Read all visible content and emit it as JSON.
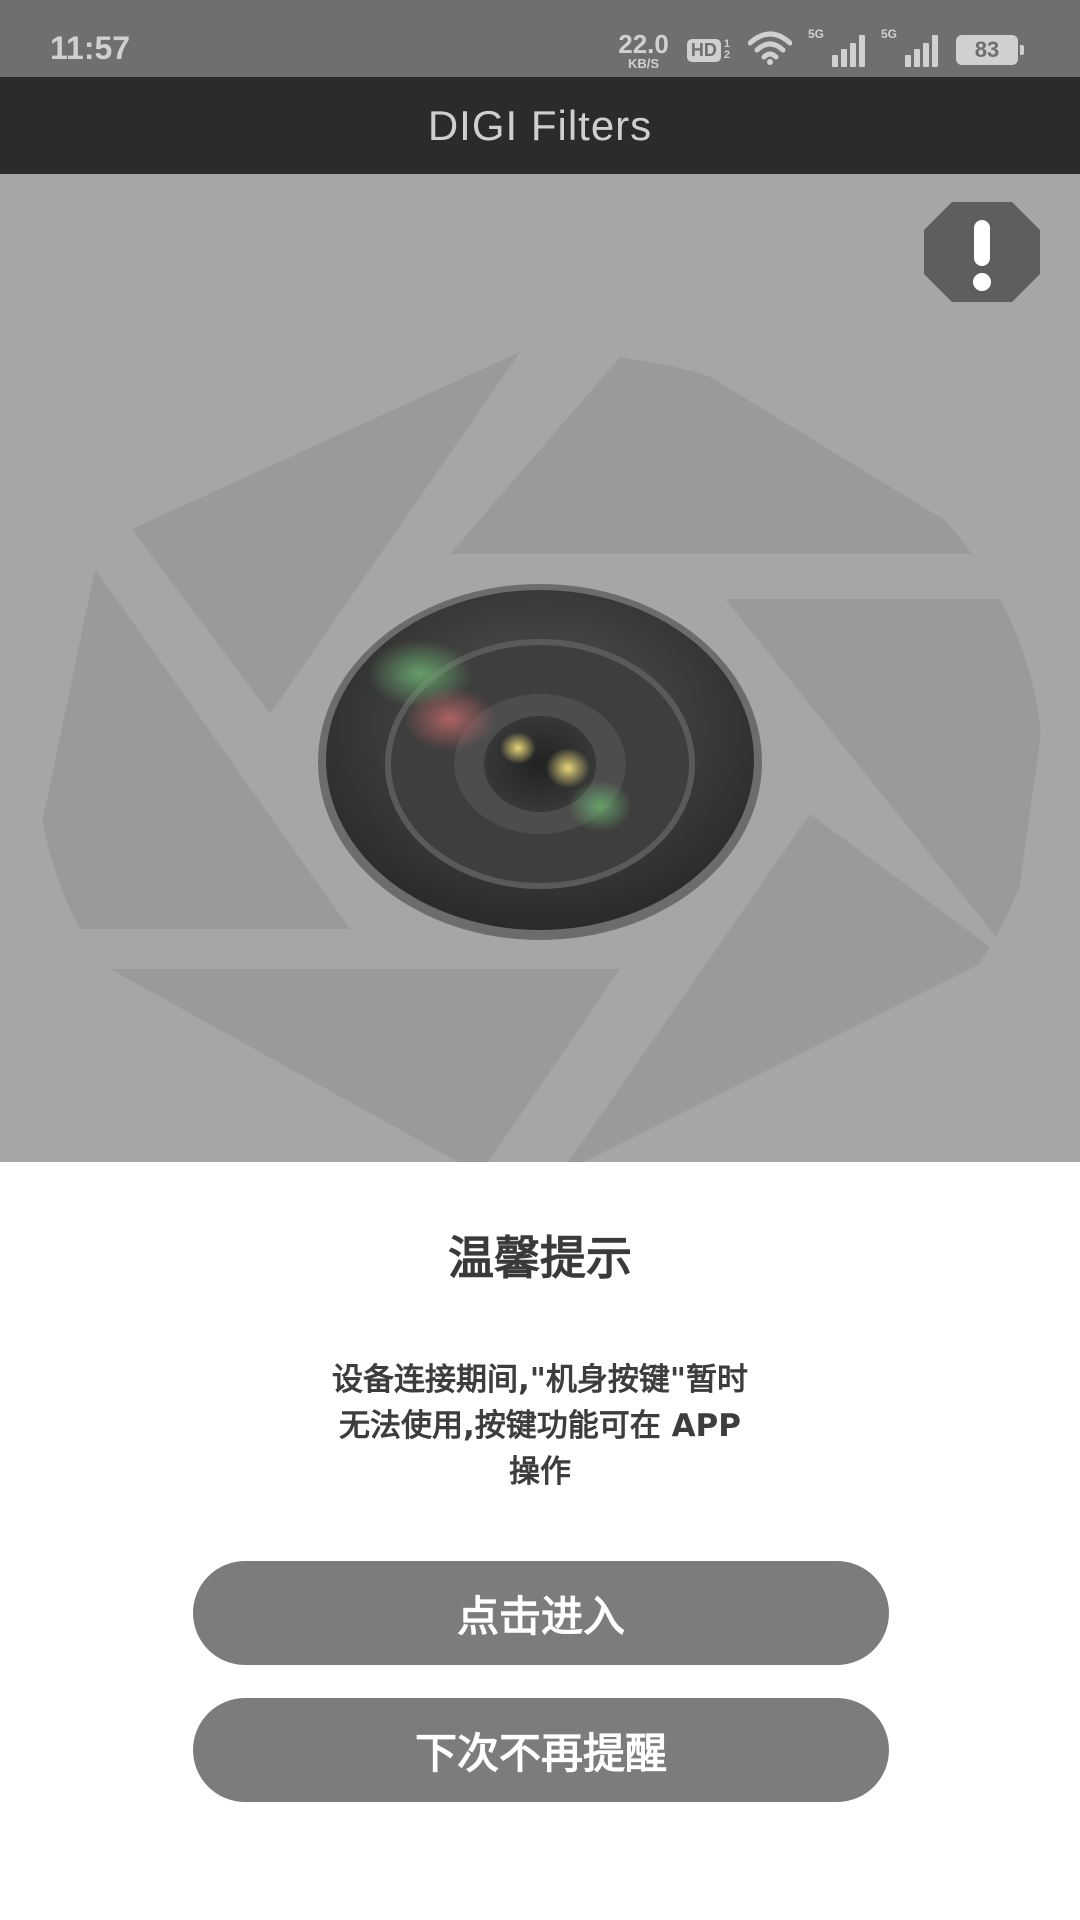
{
  "status_bar": {
    "time": "11:57",
    "net_speed_value": "22.0",
    "net_speed_unit": "KB/S",
    "hd_label": "HD",
    "hd_sub_top": "1",
    "hd_sub_bottom": "2",
    "sim1_type": "5G",
    "sim2_type": "5G",
    "battery_level": "83",
    "icons": [
      "wifi-icon",
      "signal-icon",
      "signal-icon",
      "battery-icon"
    ]
  },
  "app_bar": {
    "title": "DIGI Filters"
  },
  "hero": {
    "icons": [
      "aperture-logo",
      "camera-lens-icon",
      "warning-icon"
    ],
    "colors": {
      "background": "#a6a6a6",
      "aperture": "#9c9c9c",
      "lens_dark": "#2e2e2e"
    }
  },
  "dialog": {
    "title": "温馨提示",
    "message_lines": [
      "设备连接期间,\"机身按键\"暂时",
      "无法使用,按键功能可在 APP",
      "操作"
    ],
    "enter_button": "点击进入",
    "dismiss_button": "下次不再提醒"
  },
  "colors": {
    "status_bar": "#6f6f6f",
    "app_bar": "#2b2b2b",
    "button": "#7c7c7c",
    "button_text": "#ffffff"
  }
}
